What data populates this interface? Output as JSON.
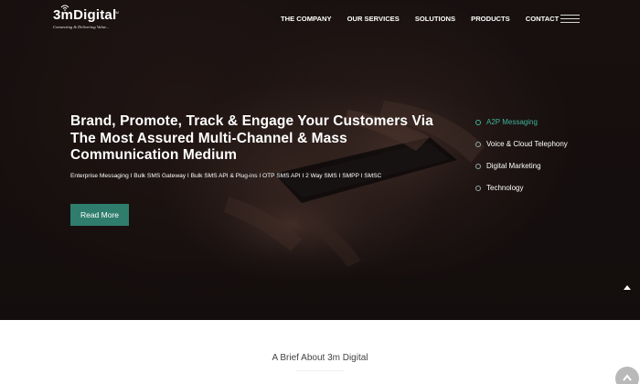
{
  "header": {
    "logo": {
      "name": "3mDigital",
      "tagline": "Connecting & Delivering Value...",
      "trademark": "TM"
    },
    "nav": [
      {
        "label": "THE COMPANY"
      },
      {
        "label": "OUR SERVICES"
      },
      {
        "label": "SOLUTIONS"
      },
      {
        "label": "PRODUCTS"
      },
      {
        "label": "CONTACT"
      }
    ],
    "menu_icon": "hamburger-icon"
  },
  "hero": {
    "headline_lines": [
      "Brand, Promote, Track & Engage Your Customers Via",
      "The Most Assured Multi-Channel & Mass",
      "Communication Medium"
    ],
    "subline": "Enterprise Messaging I Bulk SMS Gateway I Bulk SMS API & Plug-ins I OTP SMS API I 2 Way SMS I SMPP I SMSC",
    "cta_label": "Read More",
    "side_items": [
      {
        "label": "A2P Messaging",
        "active": true
      },
      {
        "label": "Voice & Cloud Telephony",
        "active": false
      },
      {
        "label": "Digital Marketing",
        "active": false
      },
      {
        "label": "Technology",
        "active": false
      }
    ],
    "scroll_arrow_icon": "chevron-up-icon"
  },
  "about": {
    "title": "A Brief About 3m Digital"
  },
  "scroll_top_icon": "arrow-up-icon",
  "colors": {
    "accent": "#2f7d6c",
    "active_item": "#3fb39a",
    "hero_background": "#1c1413"
  }
}
